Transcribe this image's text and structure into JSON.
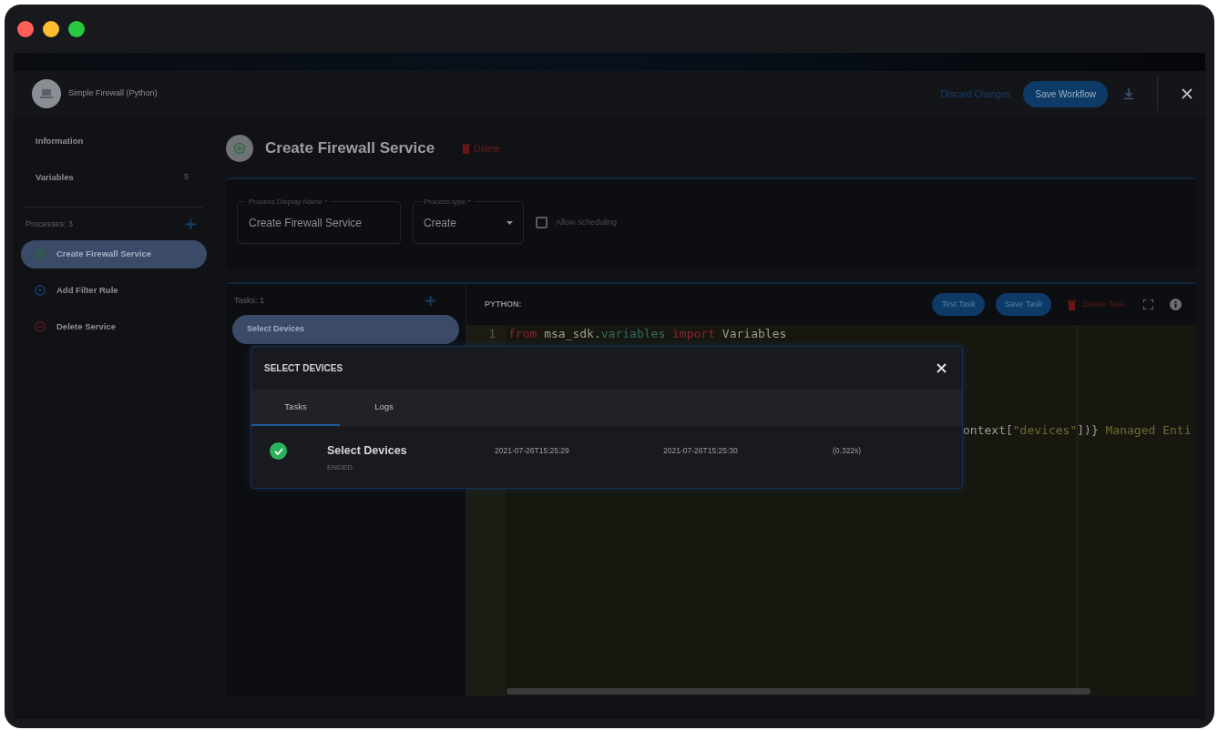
{
  "header": {
    "title": "Simple Firewall (Python)",
    "discard": "Discard Changes",
    "save": "Save Workflow"
  },
  "sidebar": {
    "items": [
      {
        "label": "Information"
      },
      {
        "label": "Variables",
        "count": "5"
      }
    ],
    "processes_label": "Processes: 3",
    "processes": [
      {
        "label": "Create Firewall Service",
        "kind": "create",
        "selected": true
      },
      {
        "label": "Add Filter Rule",
        "kind": "update",
        "selected": false
      },
      {
        "label": "Delete Service",
        "kind": "delete",
        "selected": false
      }
    ]
  },
  "process": {
    "title": "Create Firewall Service",
    "delete": "Delete"
  },
  "form": {
    "display_name_label": "Process Display Name *",
    "display_name": "Create Firewall Service",
    "type_label": "Process type *",
    "type": "Create",
    "allow_scheduling": {
      "label": "Allow scheduling",
      "checked": false
    }
  },
  "tasks": {
    "label": "Tasks: 1",
    "items": [
      {
        "label": "Select Devices",
        "selected": true
      }
    ]
  },
  "editor": {
    "language": "PYTHON:",
    "buttons": [
      "Test Task",
      "Save Task"
    ],
    "delete": "Delete Task",
    "lines": [
      {
        "number": "1",
        "tokens": [
          {
            "kind": "keyword",
            "text": "from"
          },
          {
            "kind": "plain",
            "text": " msa_sdk."
          },
          {
            "kind": "module",
            "text": "variables"
          },
          {
            "kind": "keyword",
            "text": " import"
          },
          {
            "kind": "plain",
            "text": " Variables"
          }
        ]
      }
    ],
    "fragment": {
      "tokens": [
        {
          "kind": "plain",
          "text": "ontext["
        },
        {
          "kind": "string",
          "text": "\"devices\""
        },
        {
          "kind": "plain",
          "text": "])}"
        },
        {
          "kind": "string",
          "text": " Managed Enti"
        }
      ]
    }
  },
  "modal": {
    "title": "SELECT DEVICES",
    "tabs": [
      {
        "label": "Tasks",
        "selected": true
      },
      {
        "label": "Logs",
        "selected": false
      }
    ],
    "rows": [
      {
        "kind": "success",
        "name": "Select Devices",
        "state": "ENDED",
        "start": "2021-07-26T15:25:29",
        "end": "2021-07-26T15:25:30",
        "duration": "(0.322s)"
      }
    ]
  }
}
